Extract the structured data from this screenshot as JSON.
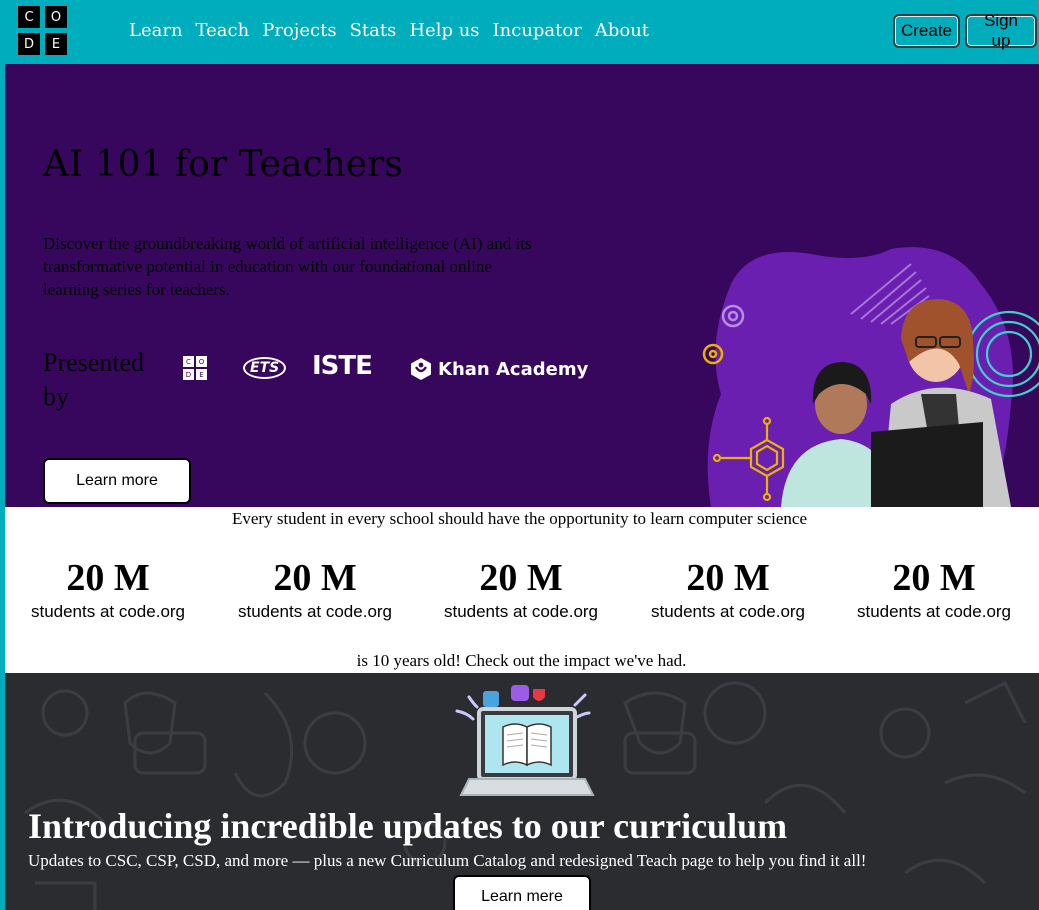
{
  "header": {
    "logo_letters": [
      "C",
      "O",
      "D",
      "E"
    ],
    "nav": [
      "Learn",
      "Teach",
      "Projects",
      "Stats",
      "Help us",
      "Incupator",
      "About"
    ],
    "create_label": "Create",
    "signup_label": "Sign up",
    "bg_color": "#00adbc"
  },
  "hero": {
    "title": "AI 101 for Teachers",
    "description": "Discover the groundbreaking world of artificial intelligence (AI) and its transformative potential in education with our foundational online learning series for teachers.",
    "presented_by": "Presented by",
    "partners": {
      "ets": "ETS",
      "iste": "ISTE",
      "khan": "Khan Academy"
    },
    "button_label": "Learn more",
    "bg_color": "#36075c"
  },
  "stats": {
    "tagline": "Every student in every school should have the opportunity to learn computer science",
    "items": [
      {
        "number": "20 M",
        "label": "students at code.org"
      },
      {
        "number": "20 M",
        "label": "students at code.org"
      },
      {
        "number": "20 M",
        "label": "students at code.org"
      },
      {
        "number": "20 M",
        "label": "students at code.org"
      },
      {
        "number": "20 M",
        "label": "students at code.org"
      }
    ],
    "impact": "is 10 years old! Check out the impact we've had."
  },
  "curriculum": {
    "title": "Introducing incredible updates to our curriculum",
    "description": "Updates to CSC, CSP, CSD, and more — plus a new Curriculum Catalog and redesigned Teach page to help you find it all!",
    "button_label": "Learn mere",
    "bg_color": "#2b2c30"
  }
}
